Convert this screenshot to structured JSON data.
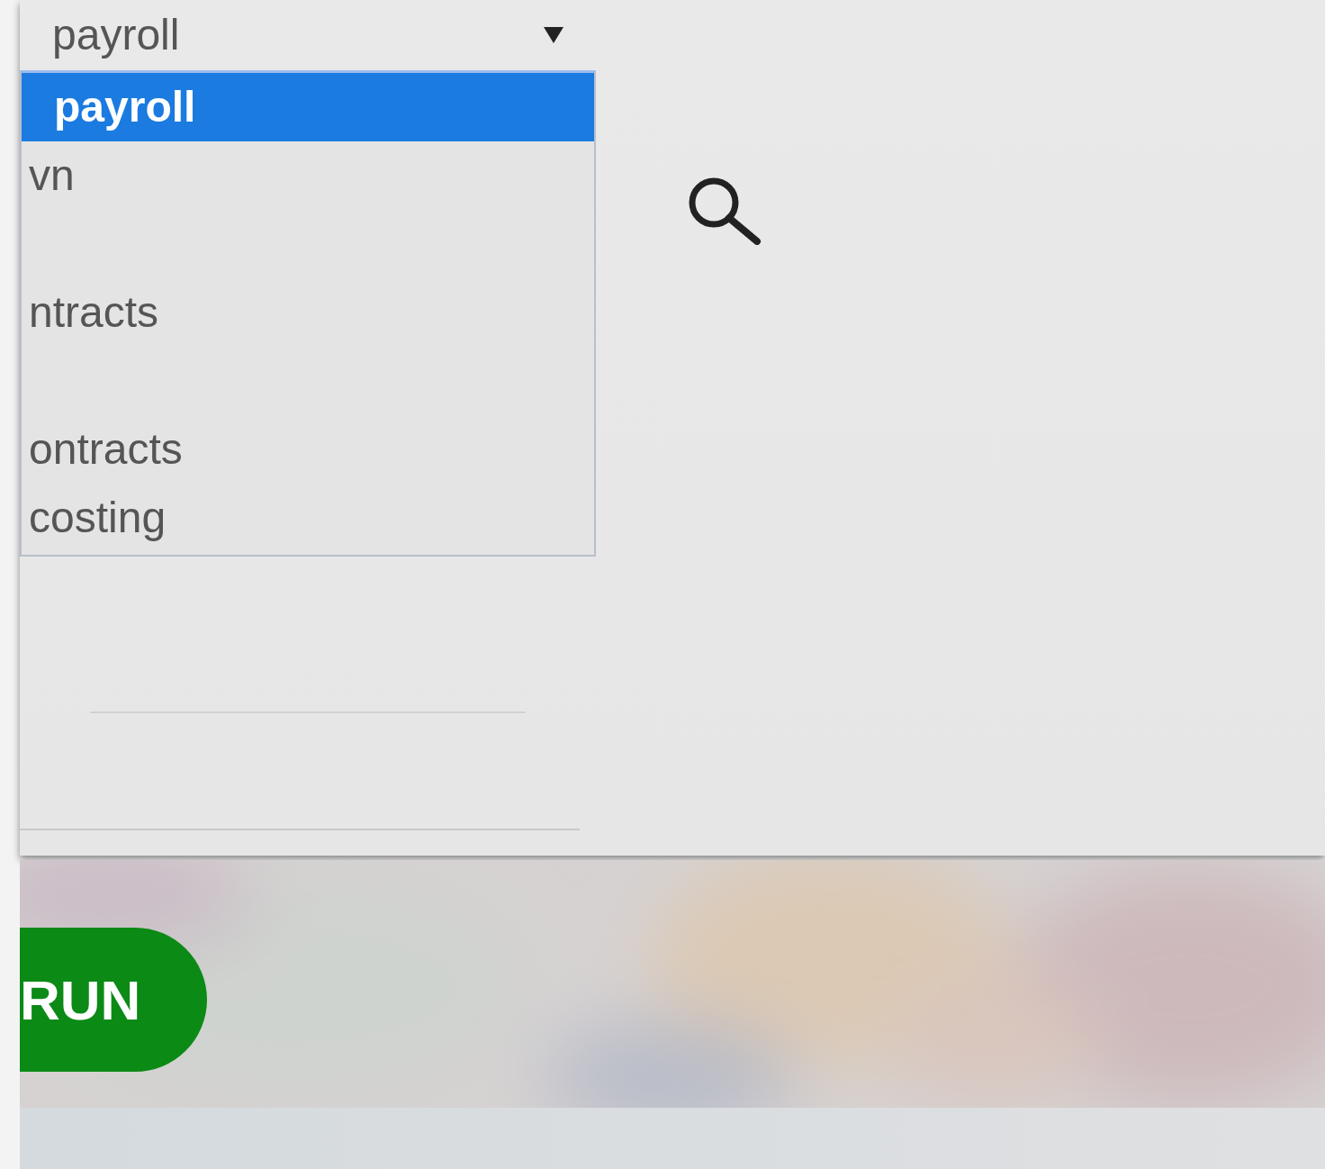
{
  "select": {
    "value": "payroll"
  },
  "options": [
    {
      "label": "payroll",
      "selected": true
    },
    {
      "label": "vn",
      "selected": false
    },
    {
      "selected": false
    },
    {
      "label": "ntracts",
      "selected": false
    },
    {
      "selected": false
    },
    {
      "label": "ontracts",
      "selected": false
    },
    {
      "label": "costing",
      "selected": false
    }
  ],
  "run_button": {
    "label": "RUN"
  }
}
